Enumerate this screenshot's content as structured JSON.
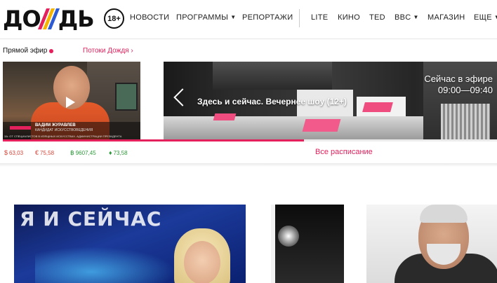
{
  "header": {
    "logo_left": "ДО",
    "logo_right": "ДЬ",
    "logo_stripe_colors": [
      "#e5215d",
      "#f4b400",
      "#2d5bd3"
    ],
    "age_rating": "18+",
    "nav": [
      {
        "label": "НОВОСТИ",
        "dropdown": false
      },
      {
        "label": "ПРОГРАММЫ",
        "dropdown": true
      },
      {
        "label": "РЕПОРТАЖИ",
        "dropdown": false
      },
      {
        "label": "LITE",
        "dropdown": false
      },
      {
        "label": "КИНО",
        "dropdown": false
      },
      {
        "label": "TED",
        "dropdown": false
      },
      {
        "label": "BBC",
        "dropdown": true
      },
      {
        "label": "МАГАЗИН",
        "dropdown": false
      },
      {
        "label": "ЕЩЕ",
        "dropdown": true
      }
    ]
  },
  "live": {
    "label": "Прямой эфир",
    "streams_link": "Потоки Дождя ›",
    "thumb": {
      "name": "ВАДИМ ЖУРАВЛЕВ",
      "role": "КАНДИДАТ ИСКУССТВОВЕДЕНИЯ",
      "ticker": "ЗА: ОТ СПЕЦИАЛИСТОВ В ИЗЯЩНЫХ ИСКУССТВАХ. АДМИНИСТРАЦИИ ПРЕЗИДЕНТА"
    },
    "banner": {
      "show_title": "Здесь и сейчас. Вечернее шоу (12+)",
      "now_label": "Сейчас в эфире",
      "time_range": "09:00—09:40"
    },
    "progress_fraction": 0.61
  },
  "rates": [
    {
      "icon": "dollar-icon",
      "symbol": "$",
      "value": "63,03",
      "color": "#d8453a"
    },
    {
      "icon": "euro-icon",
      "symbol": "€",
      "value": "75,58",
      "color": "#d8453a"
    },
    {
      "icon": "bitcoin-icon",
      "symbol": "฿",
      "value": "9607,45",
      "color": "#2f9a3c"
    },
    {
      "icon": "oil-icon",
      "symbol": "♦",
      "value": "73,58",
      "color": "#2f9a3c"
    }
  ],
  "schedule_link": "Все расписание",
  "accent_color": "#e5215d",
  "cards": [
    {
      "overlay_text": "Я И СЕЙЧАС"
    }
  ]
}
